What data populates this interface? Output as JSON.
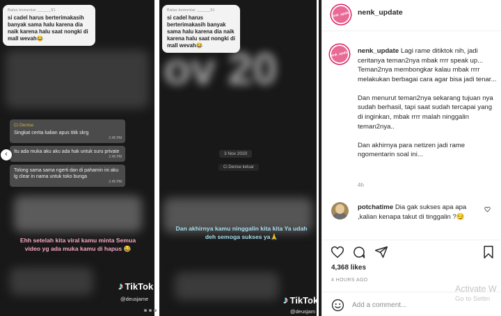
{
  "media": {
    "slide_left": {
      "reply_label": "Balas komentar ______91",
      "reply_text": "si cadel harus berterimakasih banyak sama halu karena dia naik karena halu saat nongki di mall wevah😂",
      "chat": [
        {
          "sender": "Ci Denise",
          "text": "Singkat cerita kalian apus titik skrg",
          "time": "2.45 PM"
        },
        {
          "sender": "",
          "text": "Itu ada muka aku aku ada hak untuk suru private",
          "time": "2.45 PM"
        },
        {
          "sender": "",
          "text": "Tolong sama sama ngerti dan di pahamin ini aku lg clear in nama untuk toko bunga",
          "time": "2.45 PM"
        }
      ],
      "caption": "Ehh setelah kita viral kamu minta Semua video yg ada muka kamu di hapus 😂",
      "brand": "TikTok",
      "handle": "@deusjame"
    },
    "slide_right": {
      "reply_label": "Balas komentar ______91",
      "reply_text": "si cadel harus berterimakasih banyak sama halu karena dia naik karena halu saat nongki di mall wevah😂",
      "bg_text": "ov 20",
      "date_chip": "3 Nov 2020",
      "system_msg": "Ci Denise keluar",
      "caption": "Dan akhirnya kamu ninggalin kita kita Ya udah deh semoga sukses ya🙏",
      "brand": "TikTok",
      "handle": "@deusjam"
    },
    "prev_icon": "chevron-left-icon",
    "carousel_dots": 3
  },
  "post": {
    "username": "nenk_update",
    "avatar_text": "nenk_update",
    "caption_username": "nenk_update",
    "caption_paragraphs": [
      "Lagi rame ditiktok nih, jadi ceritanya teman2nya mbak rrrr speak up... Teman2nya membongkar kalau mbak rrrr melakukan berbagai cara agar bisa jadi tenar...",
      "Dan menurut teman2nya sekarang tujuan nya sudah berhasil, tapi saat sudah tercapai yang di inginkan, mbak rrrr malah ninggalin teman2nya..",
      "Dan akhirnya para netizen jadi rame ngomentarin soal ini..."
    ],
    "caption_age": "4h",
    "comment": {
      "username": "potchatime",
      "text": "Dia gak sukses apa apa ,kalian kenapa takut di tinggalin ?😏"
    },
    "likes": "4,368 likes",
    "posted": "4 HOURS AGO",
    "add_comment_placeholder": "Add a comment...",
    "icons": [
      "heart-icon",
      "comment-icon",
      "share-icon",
      "bookmark-icon",
      "emoji-icon"
    ]
  },
  "watermark": {
    "line1": "Activate W",
    "line2": "Go to Settin"
  },
  "colors": {
    "avatar_ring": "#d81b60",
    "secondary_text": "#8e8e8e",
    "border": "#efefef"
  }
}
